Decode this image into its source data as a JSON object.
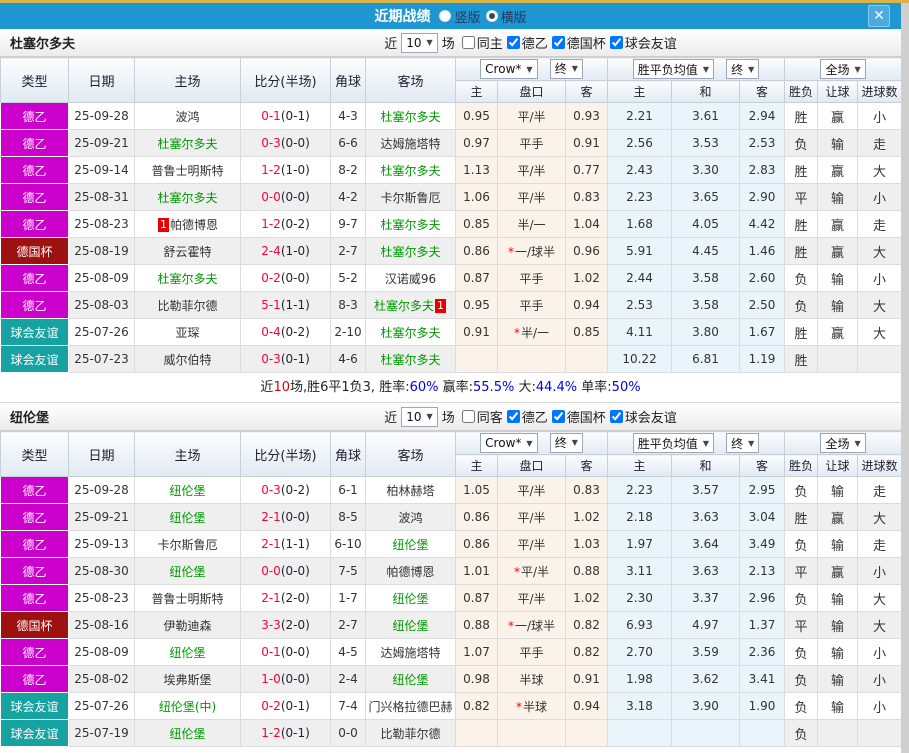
{
  "topbar": {
    "title": "近期战绩",
    "vertical_label": "竖版",
    "vertical_checked": false,
    "horizontal_label": "横版",
    "horizontal_checked": true,
    "close": "✕"
  },
  "colors": {
    "titlebar_blue": "#1e96d2",
    "gold_line": "#d8b44a",
    "league2_badge": "#cc00cc",
    "cup_badge": "#9e1111",
    "friendly_badge": "#17a2a2",
    "win_red": "#e00000",
    "draw_blue": "#0011cc",
    "loss_green": "#008000",
    "score_red": "#ff0036",
    "team_green": "#009900",
    "odds_col_bg": "#fbf3e9",
    "avg_col_bg": "#e9f4fb"
  },
  "sections": [
    {
      "team": "杜塞尔多夫",
      "filter": {
        "near": "近",
        "count": "10",
        "games": "场",
        "same_label": "同主",
        "same_checked": false,
        "leagues": [
          {
            "label": "德乙",
            "checked": true
          },
          {
            "label": "德国杯",
            "checked": true
          },
          {
            "label": "球会友谊",
            "checked": true
          }
        ]
      },
      "header": {
        "type": "类型",
        "date": "日期",
        "home": "主场",
        "score": "比分(半场)",
        "corner": "角球",
        "away": "客场",
        "company": "Crow*",
        "final1": "终",
        "avg": "胜平负均值",
        "final2": "终",
        "fulltime": "全场",
        "sub": [
          "主",
          "盘口",
          "客",
          "主",
          "和",
          "客",
          "胜负",
          "让球",
          "进球数"
        ]
      },
      "rows": [
        {
          "type": "德乙",
          "type_color": "#cc00cc",
          "date": "25-09-28",
          "home": "波鸿",
          "home_green": false,
          "home_rank": "",
          "ft": "0-1",
          "ht": "(0-1)",
          "corner": "4-3",
          "away": "杜塞尔多夫",
          "away_green": true,
          "away_rank": "",
          "oh": "0.95",
          "hc": "平/半",
          "star": false,
          "oa": "0.93",
          "avg_h": "2.21",
          "avg_d": "3.61",
          "avg_a": "2.94",
          "res": "胜",
          "hres": "赢",
          "gres": "小"
        },
        {
          "type": "德乙",
          "type_color": "#cc00cc",
          "date": "25-09-21",
          "home": "杜塞尔多夫",
          "home_green": true,
          "home_rank": "",
          "ft": "0-3",
          "ht": "(0-0)",
          "corner": "6-6",
          "away": "达姆施塔特",
          "away_green": false,
          "away_rank": "",
          "oh": "0.97",
          "hc": "平手",
          "star": false,
          "oa": "0.91",
          "avg_h": "2.56",
          "avg_d": "3.53",
          "avg_a": "2.53",
          "res": "负",
          "hres": "输",
          "gres": "走"
        },
        {
          "type": "德乙",
          "type_color": "#cc00cc",
          "date": "25-09-14",
          "home": "普鲁士明斯特",
          "home_green": false,
          "home_rank": "",
          "ft": "1-2",
          "ht": "(1-0)",
          "corner": "8-2",
          "away": "杜塞尔多夫",
          "away_green": true,
          "away_rank": "",
          "oh": "1.13",
          "hc": "平/半",
          "star": false,
          "oa": "0.77",
          "avg_h": "2.43",
          "avg_d": "3.30",
          "avg_a": "2.83",
          "res": "胜",
          "hres": "赢",
          "gres": "大"
        },
        {
          "type": "德乙",
          "type_color": "#cc00cc",
          "date": "25-08-31",
          "home": "杜塞尔多夫",
          "home_green": true,
          "home_rank": "",
          "ft": "0-0",
          "ht": "(0-0)",
          "corner": "4-2",
          "away": "卡尔斯鲁厄",
          "away_green": false,
          "away_rank": "",
          "oh": "1.06",
          "hc": "平/半",
          "star": false,
          "oa": "0.83",
          "avg_h": "2.23",
          "avg_d": "3.65",
          "avg_a": "2.90",
          "res": "平",
          "hres": "输",
          "gres": "小"
        },
        {
          "type": "德乙",
          "type_color": "#cc00cc",
          "date": "25-08-23",
          "home": "帕德博恩",
          "home_green": false,
          "home_rank": "1",
          "ft": "1-2",
          "ht": "(0-2)",
          "corner": "9-7",
          "away": "杜塞尔多夫",
          "away_green": true,
          "away_rank": "",
          "oh": "0.85",
          "hc": "半/一",
          "star": false,
          "oa": "1.04",
          "avg_h": "1.68",
          "avg_d": "4.05",
          "avg_a": "4.42",
          "res": "胜",
          "hres": "赢",
          "gres": "走"
        },
        {
          "type": "德国杯",
          "type_color": "#9e1111",
          "date": "25-08-19",
          "home": "舒云霍特",
          "home_green": false,
          "home_rank": "",
          "ft": "2-4",
          "ht": "(1-0)",
          "corner": "2-7",
          "away": "杜塞尔多夫",
          "away_green": true,
          "away_rank": "",
          "oh": "0.86",
          "hc": "一/球半",
          "star": true,
          "oa": "0.96",
          "avg_h": "5.91",
          "avg_d": "4.45",
          "avg_a": "1.46",
          "res": "胜",
          "hres": "赢",
          "gres": "大"
        },
        {
          "type": "德乙",
          "type_color": "#cc00cc",
          "date": "25-08-09",
          "home": "杜塞尔多夫",
          "home_green": true,
          "home_rank": "",
          "ft": "0-2",
          "ht": "(0-0)",
          "corner": "5-2",
          "away": "汉诺威96",
          "away_green": false,
          "away_rank": "",
          "oh": "0.87",
          "hc": "平手",
          "star": false,
          "oa": "1.02",
          "avg_h": "2.44",
          "avg_d": "3.58",
          "avg_a": "2.60",
          "res": "负",
          "hres": "输",
          "gres": "小"
        },
        {
          "type": "德乙",
          "type_color": "#cc00cc",
          "date": "25-08-03",
          "home": "比勒菲尔德",
          "home_green": false,
          "home_rank": "",
          "ft": "5-1",
          "ht": "(1-1)",
          "corner": "8-3",
          "away": "杜塞尔多夫",
          "away_green": true,
          "away_rank": "1",
          "oh": "0.95",
          "hc": "平手",
          "star": false,
          "oa": "0.94",
          "avg_h": "2.53",
          "avg_d": "3.58",
          "avg_a": "2.50",
          "res": "负",
          "hres": "输",
          "gres": "大"
        },
        {
          "type": "球会友谊",
          "type_color": "#17a2a2",
          "date": "25-07-26",
          "home": "亚琛",
          "home_green": false,
          "home_rank": "",
          "ft": "0-4",
          "ht": "(0-2)",
          "corner": "2-10",
          "away": "杜塞尔多夫",
          "away_green": true,
          "away_rank": "",
          "oh": "0.91",
          "hc": "半/一",
          "star": true,
          "oa": "0.85",
          "avg_h": "4.11",
          "avg_d": "3.80",
          "avg_a": "1.67",
          "res": "胜",
          "hres": "赢",
          "gres": "大"
        },
        {
          "type": "球会友谊",
          "type_color": "#17a2a2",
          "date": "25-07-23",
          "home": "威尔伯特",
          "home_green": false,
          "home_rank": "",
          "ft": "0-3",
          "ht": "(0-1)",
          "corner": "4-6",
          "away": "杜塞尔多夫",
          "away_green": true,
          "away_rank": "",
          "oh": "",
          "hc": "",
          "star": false,
          "oa": "",
          "avg_h": "10.22",
          "avg_d": "6.81",
          "avg_a": "1.19",
          "res": "胜",
          "hres": "",
          "gres": ""
        }
      ],
      "summary": [
        {
          "t": "近",
          "c": "k"
        },
        {
          "t": "10",
          "c": "r"
        },
        {
          "t": "场,胜6平1负3, ",
          "c": "k"
        },
        {
          "t": "胜率:",
          "c": "k"
        },
        {
          "t": "60%",
          "c": "b"
        },
        {
          "t": " 赢率:",
          "c": "k"
        },
        {
          "t": "55.5%",
          "c": "b"
        },
        {
          "t": " 大:",
          "c": "k"
        },
        {
          "t": "44.4%",
          "c": "b"
        },
        {
          "t": " 单率:",
          "c": "k"
        },
        {
          "t": "50%",
          "c": "b"
        }
      ]
    },
    {
      "team": "纽伦堡",
      "filter": {
        "near": "近",
        "count": "10",
        "games": "场",
        "same_label": "同客",
        "same_checked": false,
        "leagues": [
          {
            "label": "德乙",
            "checked": true
          },
          {
            "label": "德国杯",
            "checked": true
          },
          {
            "label": "球会友谊",
            "checked": true
          }
        ]
      },
      "header": {
        "type": "类型",
        "date": "日期",
        "home": "主场",
        "score": "比分(半场)",
        "corner": "角球",
        "away": "客场",
        "company": "Crow*",
        "final1": "终",
        "avg": "胜平负均值",
        "final2": "终",
        "fulltime": "全场",
        "sub": [
          "主",
          "盘口",
          "客",
          "主",
          "和",
          "客",
          "胜负",
          "让球",
          "进球数"
        ]
      },
      "rows": [
        {
          "type": "德乙",
          "type_color": "#cc00cc",
          "date": "25-09-28",
          "home": "纽伦堡",
          "home_green": true,
          "home_rank": "",
          "ft": "0-3",
          "ht": "(0-2)",
          "corner": "6-1",
          "away": "柏林赫塔",
          "away_green": false,
          "away_rank": "",
          "oh": "1.05",
          "hc": "平/半",
          "star": false,
          "oa": "0.83",
          "avg_h": "2.23",
          "avg_d": "3.57",
          "avg_a": "2.95",
          "res": "负",
          "hres": "输",
          "gres": "走"
        },
        {
          "type": "德乙",
          "type_color": "#cc00cc",
          "date": "25-09-21",
          "home": "纽伦堡",
          "home_green": true,
          "home_rank": "",
          "ft": "2-1",
          "ht": "(0-0)",
          "corner": "8-5",
          "away": "波鸿",
          "away_green": false,
          "away_rank": "",
          "oh": "0.86",
          "hc": "平/半",
          "star": false,
          "oa": "1.02",
          "avg_h": "2.18",
          "avg_d": "3.63",
          "avg_a": "3.04",
          "res": "胜",
          "hres": "赢",
          "gres": "大"
        },
        {
          "type": "德乙",
          "type_color": "#cc00cc",
          "date": "25-09-13",
          "home": "卡尔斯鲁厄",
          "home_green": false,
          "home_rank": "",
          "ft": "2-1",
          "ht": "(1-1)",
          "corner": "6-10",
          "away": "纽伦堡",
          "away_green": true,
          "away_rank": "",
          "oh": "0.86",
          "hc": "平/半",
          "star": false,
          "oa": "1.03",
          "avg_h": "1.97",
          "avg_d": "3.64",
          "avg_a": "3.49",
          "res": "负",
          "hres": "输",
          "gres": "走"
        },
        {
          "type": "德乙",
          "type_color": "#cc00cc",
          "date": "25-08-30",
          "home": "纽伦堡",
          "home_green": true,
          "home_rank": "",
          "ft": "0-0",
          "ht": "(0-0)",
          "corner": "7-5",
          "away": "帕德博恩",
          "away_green": false,
          "away_rank": "",
          "oh": "1.01",
          "hc": "平/半",
          "star": true,
          "oa": "0.88",
          "avg_h": "3.11",
          "avg_d": "3.63",
          "avg_a": "2.13",
          "res": "平",
          "hres": "赢",
          "gres": "小"
        },
        {
          "type": "德乙",
          "type_color": "#cc00cc",
          "date": "25-08-23",
          "home": "普鲁士明斯特",
          "home_green": false,
          "home_rank": "",
          "ft": "2-1",
          "ht": "(2-0)",
          "corner": "1-7",
          "away": "纽伦堡",
          "away_green": true,
          "away_rank": "",
          "oh": "0.87",
          "hc": "平/半",
          "star": false,
          "oa": "1.02",
          "avg_h": "2.30",
          "avg_d": "3.37",
          "avg_a": "2.96",
          "res": "负",
          "hres": "输",
          "gres": "大"
        },
        {
          "type": "德国杯",
          "type_color": "#9e1111",
          "date": "25-08-16",
          "home": "伊勒迪森",
          "home_green": false,
          "home_rank": "",
          "ft": "3-3",
          "ht": "(2-0)",
          "corner": "2-7",
          "away": "纽伦堡",
          "away_green": true,
          "away_rank": "",
          "oh": "0.88",
          "hc": "一/球半",
          "star": true,
          "oa": "0.82",
          "avg_h": "6.93",
          "avg_d": "4.97",
          "avg_a": "1.37",
          "res": "平",
          "hres": "输",
          "gres": "大"
        },
        {
          "type": "德乙",
          "type_color": "#cc00cc",
          "date": "25-08-09",
          "home": "纽伦堡",
          "home_green": true,
          "home_rank": "",
          "ft": "0-1",
          "ht": "(0-0)",
          "corner": "4-5",
          "away": "达姆施塔特",
          "away_green": false,
          "away_rank": "",
          "oh": "1.07",
          "hc": "平手",
          "star": false,
          "oa": "0.82",
          "avg_h": "2.70",
          "avg_d": "3.59",
          "avg_a": "2.36",
          "res": "负",
          "hres": "输",
          "gres": "小"
        },
        {
          "type": "德乙",
          "type_color": "#cc00cc",
          "date": "25-08-02",
          "home": "埃弗斯堡",
          "home_green": false,
          "home_rank": "",
          "ft": "1-0",
          "ht": "(0-0)",
          "corner": "2-4",
          "away": "纽伦堡",
          "away_green": true,
          "away_rank": "",
          "oh": "0.98",
          "hc": "半球",
          "star": false,
          "oa": "0.91",
          "avg_h": "1.98",
          "avg_d": "3.62",
          "avg_a": "3.41",
          "res": "负",
          "hres": "输",
          "gres": "小"
        },
        {
          "type": "球会友谊",
          "type_color": "#17a2a2",
          "date": "25-07-26",
          "home": "纽伦堡(中)",
          "home_green": true,
          "home_rank": "",
          "ft": "0-2",
          "ht": "(0-1)",
          "corner": "7-4",
          "away": "门兴格拉德巴赫",
          "away_green": false,
          "away_rank": "",
          "oh": "0.82",
          "hc": "半球",
          "star": true,
          "oa": "0.94",
          "avg_h": "3.18",
          "avg_d": "3.90",
          "avg_a": "1.90",
          "res": "负",
          "hres": "输",
          "gres": "小"
        },
        {
          "type": "球会友谊",
          "type_color": "#17a2a2",
          "date": "25-07-19",
          "home": "纽伦堡",
          "home_green": true,
          "home_rank": "",
          "ft": "1-2",
          "ht": "(0-1)",
          "corner": "0-0",
          "away": "比勒菲尔德",
          "away_green": false,
          "away_rank": "",
          "oh": "",
          "hc": "",
          "star": false,
          "oa": "",
          "avg_h": "",
          "avg_d": "",
          "avg_a": "",
          "res": "负",
          "hres": "",
          "gres": ""
        }
      ],
      "summary": null
    }
  ]
}
